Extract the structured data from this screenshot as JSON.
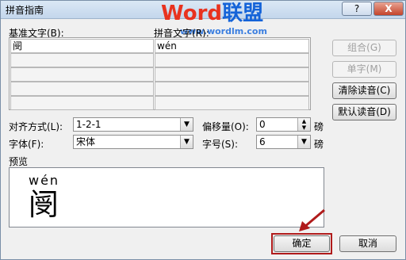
{
  "titlebar": {
    "title": "拼音指南",
    "help": "?",
    "close": "X"
  },
  "watermark": {
    "part1": "Word",
    "part2": "联盟",
    "url": "www.wordlm.com"
  },
  "grid": {
    "base_label": "基准文字(B):",
    "ruby_label": "拼音文字(R):",
    "rows": [
      {
        "base": "阌",
        "ruby": "wén"
      },
      {
        "base": "",
        "ruby": ""
      },
      {
        "base": "",
        "ruby": ""
      },
      {
        "base": "",
        "ruby": ""
      },
      {
        "base": "",
        "ruby": ""
      }
    ]
  },
  "side_buttons": {
    "group": "组合(G)",
    "mono": "单字(M)",
    "clear": "清除读音(C)",
    "default": "默认读音(D)"
  },
  "options": {
    "alignment_label": "对齐方式(L):",
    "alignment_value": "1-2-1",
    "offset_label": "偏移量(O):",
    "offset_value": "0",
    "offset_unit": "磅",
    "font_label": "字体(F):",
    "font_value": "宋体",
    "size_label": "字号(S):",
    "size_value": "6",
    "size_unit": "磅"
  },
  "preview": {
    "label": "预览",
    "pinyin": "wén",
    "char": "阌"
  },
  "footer": {
    "ok": "确定",
    "cancel": "取消"
  }
}
